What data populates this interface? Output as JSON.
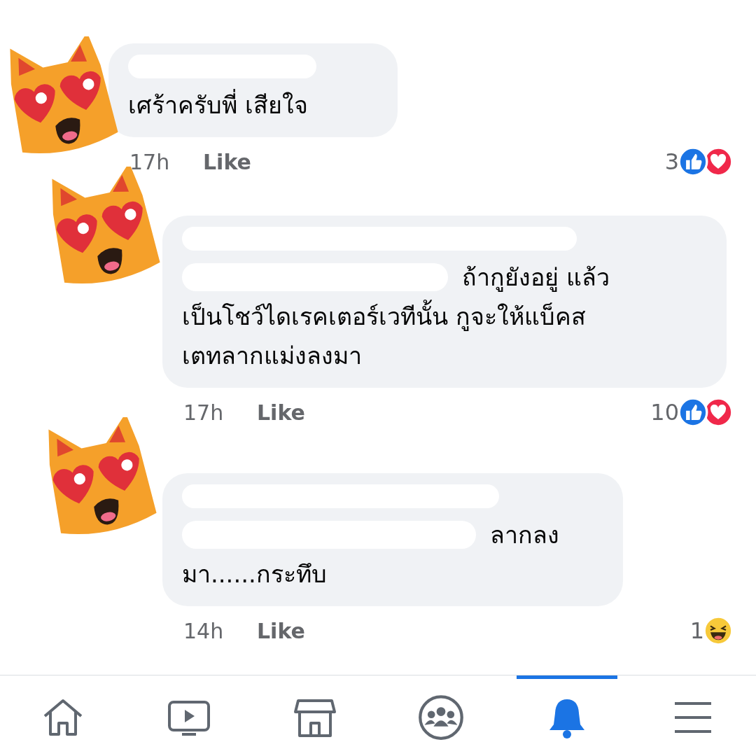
{
  "comments": [
    {
      "text": "เศร้าครับพี่ เสียใจ",
      "time": "17h",
      "like_label": "Like",
      "reaction_count": "3",
      "reactions": [
        {
          "kind": "like"
        },
        {
          "kind": "love"
        }
      ]
    },
    {
      "mention_line": "ถ้ากูยังอยู่ แล้ว",
      "text": "เป็นโชว์ไดเรคเตอร์เวทีนั้น กูจะให้แบ็คส\nเตทลากแม่งลงมา",
      "time": "17h",
      "like_label": "Like",
      "reaction_count": "10",
      "reactions": [
        {
          "kind": "like"
        },
        {
          "kind": "love"
        }
      ]
    },
    {
      "mention_line": "ลากลง",
      "text": "มา......กระทึบ",
      "time": "14h",
      "like_label": "Like",
      "reaction_count": "1",
      "reactions": [
        {
          "kind": "haha"
        }
      ]
    }
  ],
  "nav": [
    {
      "kind": "home",
      "selected": false
    },
    {
      "kind": "video",
      "selected": false
    },
    {
      "kind": "marketplace",
      "selected": false
    },
    {
      "kind": "groups",
      "selected": false
    },
    {
      "kind": "notifications",
      "selected": true
    },
    {
      "kind": "menu",
      "selected": false
    }
  ]
}
